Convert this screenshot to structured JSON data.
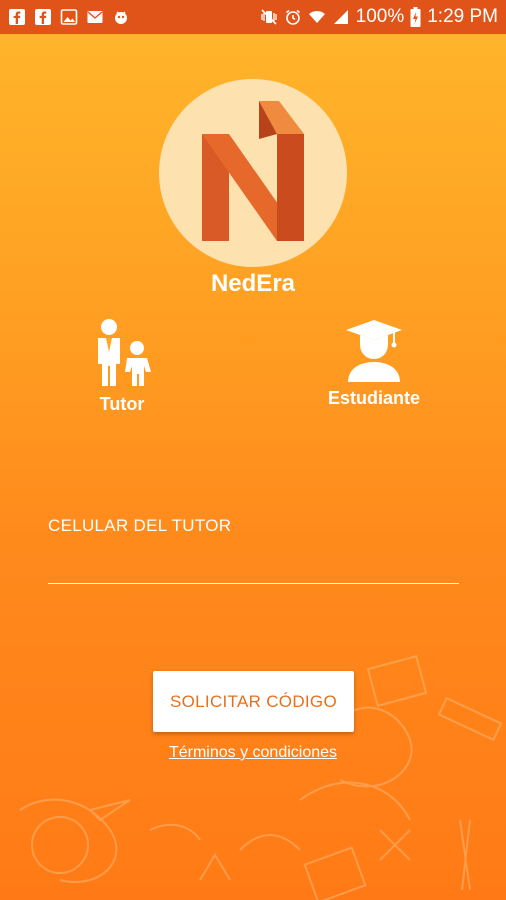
{
  "status_bar": {
    "left_icons": [
      "facebook-icon",
      "facebook-icon",
      "image-icon",
      "mail-icon",
      "bug-icon"
    ],
    "battery": "100%",
    "time": "1:29 PM"
  },
  "app": {
    "name": "NedEra"
  },
  "roles": [
    {
      "label": "Tutor",
      "icon": "parent-child-icon"
    },
    {
      "label": "Estudiante",
      "icon": "graduate-icon"
    }
  ],
  "form": {
    "phone_label": "CELULAR DEL TUTOR",
    "phone_value": ""
  },
  "actions": {
    "request_code": "SOLICITAR CÓDIGO",
    "terms": "Términos y condiciones"
  },
  "colors": {
    "accent": "#e6701e",
    "status_bar": "#e0541a",
    "background_top": "#ffb72b",
    "background_bottom": "#ff7a16"
  }
}
